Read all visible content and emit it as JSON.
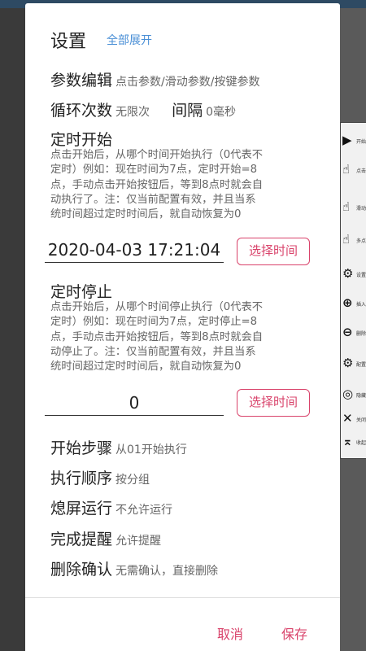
{
  "dialog": {
    "title": "设置",
    "expand_all": "全部展开"
  },
  "params": {
    "label": "参数编辑",
    "value": "点击参数/滑动参数/按键参数"
  },
  "loop": {
    "label": "循环次数",
    "value": "无限次",
    "interval_label": "间隔",
    "interval_value": "0毫秒"
  },
  "timer_start": {
    "title": "定时开始",
    "desc_lines": [
      "点击开始后，从哪个时间开始执行（0代表不",
      "定时）例如：现在时间为7点，定时开始=8",
      "点，手动点击开始按钮后，等到8点时就会自",
      "动执行了。注：仅当前配置有效，并且当系",
      "统时间超过定时时间后，就自动恢复为0"
    ],
    "value": "2020-04-03 17:21:04",
    "button": "选择时间"
  },
  "timer_stop": {
    "title": "定时停止",
    "desc_lines": [
      "点击开始后，从哪个时间停止执行（0代表不",
      "定时）例如：现在时间为7点，定时停止=8",
      "点，手动点击开始按钮后，等到8点时就会自",
      "动停止了。注：仅当前配置有效，并且当系",
      "统时间超过定时时间后，就自动恢复为0"
    ],
    "value": "0",
    "button": "选择时间"
  },
  "start_step": {
    "label": "开始步骤",
    "value": "从01开始执行"
  },
  "exec_order": {
    "label": "执行顺序",
    "value": "按分组"
  },
  "screen_off": {
    "label": "熄屏运行",
    "value": "不允许运行"
  },
  "done_remind": {
    "label": "完成提醒",
    "value": "允许提醒"
  },
  "delete_confirm": {
    "label": "删除确认",
    "value": "无需确认，直接删除"
  },
  "footer": {
    "cancel": "取消",
    "save": "保存"
  },
  "floatbar": [
    {
      "icon": "play-icon",
      "glyph": "▶",
      "label": "开始"
    },
    {
      "icon": "tap-icon",
      "glyph": "☝",
      "label": "点击"
    },
    {
      "icon": "swipe-icon",
      "glyph": "☝",
      "label": "滑动"
    },
    {
      "icon": "multi-tap-icon",
      "glyph": "☝",
      "label": "多点"
    },
    {
      "icon": "gear-icon",
      "glyph": "⚙",
      "label": "设置"
    },
    {
      "icon": "plus-circle-icon",
      "glyph": "⊕",
      "label": "插入"
    },
    {
      "icon": "minus-circle-icon",
      "glyph": "⊖",
      "label": "删除"
    },
    {
      "icon": "config-icon",
      "glyph": "⚙",
      "label": "配置"
    },
    {
      "icon": "hide-icon",
      "glyph": "◎",
      "label": "隐藏"
    },
    {
      "icon": "close-icon",
      "glyph": "✕",
      "label": "关闭"
    },
    {
      "icon": "collapse-icon",
      "glyph": "⌅",
      "label": "收起"
    }
  ],
  "colors": {
    "accent": "#d9436b",
    "link": "#4a8fd6",
    "status_bar": "#2e4a63"
  }
}
